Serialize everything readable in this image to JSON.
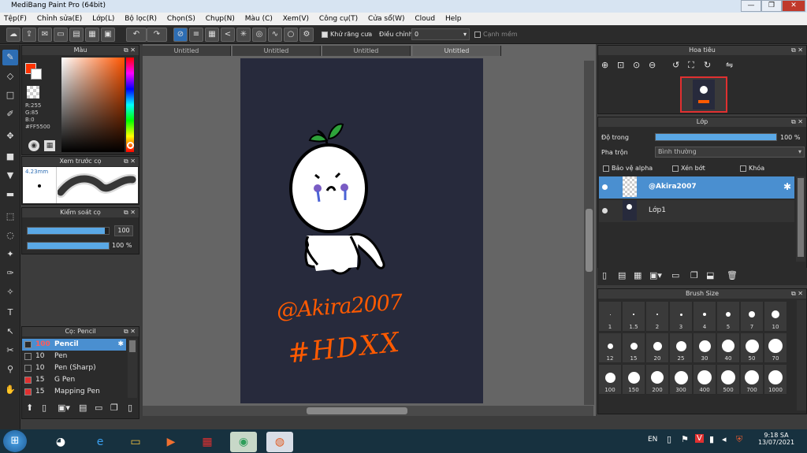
{
  "window": {
    "title": "MediBang Paint Pro (64bit)"
  },
  "menu": [
    "Tệp(F)",
    "Chỉnh sửa(E)",
    "Lớp(L)",
    "Bộ lọc(R)",
    "Chọn(S)",
    "Chụp(N)",
    "Màu (C)",
    "Xem(V)",
    "Công cụ(T)",
    "Cửa sổ(W)",
    "Cloud",
    "Help"
  ],
  "toolbar": {
    "antialias": "Khử răng cưa",
    "adjust_label": "Điều chỉnh",
    "adjust_value": "0",
    "smooth": "Cạnh mềm"
  },
  "color_panel": {
    "title": "Màu",
    "r": "R:255",
    "g": "G:85",
    "b": "B:0",
    "hex": "#FF5500",
    "fg": "#ff3300"
  },
  "brush_preview": {
    "title": "Xem trước cọ",
    "size": "4.23mm"
  },
  "brush_control": {
    "title": "Kiểm soát cọ",
    "size_value": "100",
    "opacity_value": "100 %",
    "size_fill": 0.95,
    "opacity_fill": 1.0
  },
  "brush_list": {
    "title": "Cọ: Pencil",
    "items": [
      {
        "size": "100",
        "name": "Pencil",
        "color": "#2a2a2a"
      },
      {
        "size": "10",
        "name": "Pen",
        "color": "#2a2a2a"
      },
      {
        "size": "10",
        "name": "Pen (Sharp)",
        "color": "#2a2a2a"
      },
      {
        "size": "15",
        "name": "G Pen",
        "color": "#e03030"
      },
      {
        "size": "15",
        "name": "Mapping Pen",
        "color": "#e03030"
      }
    ]
  },
  "tabs": [
    "Untitled",
    "Untitled",
    "Untitled",
    "Untitled"
  ],
  "drawing": {
    "text1": "@Akira2007",
    "text2": "#HDXX"
  },
  "navigator": {
    "title": "Hoa tiêu"
  },
  "layers": {
    "title": "Lớp",
    "opacity_label": "Độ trong",
    "opacity_value": "100 %",
    "blend_label": "Pha trộn",
    "blend_value": "Bình thường",
    "protect_alpha": "Bảo vệ alpha",
    "clipping": "Xén bớt",
    "lock": "Khóa",
    "items": [
      {
        "name": "@Akira2007"
      },
      {
        "name": "Lớp1"
      }
    ]
  },
  "brush_size": {
    "title": "Brush Size",
    "sizes": [
      "1",
      "1.5",
      "2",
      "3",
      "4",
      "5",
      "7",
      "10",
      "12",
      "15",
      "20",
      "25",
      "30",
      "40",
      "50",
      "70",
      "100",
      "150",
      "200",
      "300",
      "400",
      "500",
      "700",
      "1000"
    ]
  },
  "taskbar": {
    "lang": "EN",
    "time": "9:18 SA",
    "date": "13/07/2021"
  }
}
